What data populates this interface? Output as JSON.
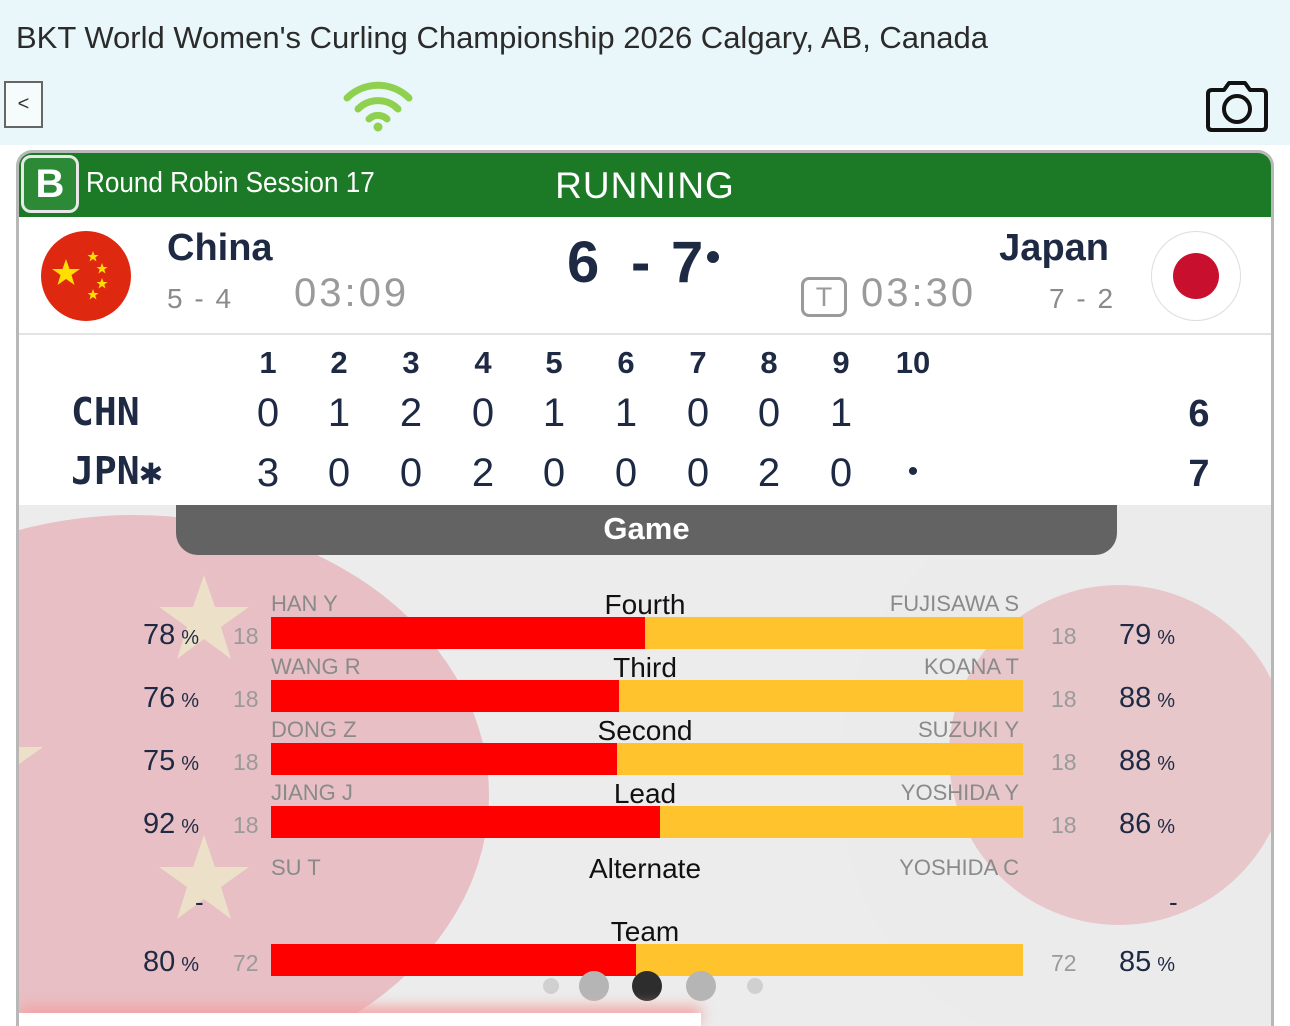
{
  "app": {
    "title": "BKT World Women's Curling Championship 2026 Calgary, AB, Canada",
    "back_label": "<",
    "icons": {
      "connection": "wifi-icon",
      "screenshot": "camera-icon"
    }
  },
  "game": {
    "sheet": "B",
    "session": "Round Robin Session 17",
    "status": "RUNNING",
    "timeout_label": "T",
    "teams": {
      "china": {
        "name": "China",
        "code": "CHN",
        "record": "5 - 4",
        "clock": "03:09",
        "score": "6",
        "total": "6",
        "flag_color": "#de2910"
      },
      "japan": {
        "name": "Japan",
        "code": "JPN",
        "hammer_mark": "✱",
        "record": "7 - 2",
        "clock": "03:30",
        "score": "7",
        "total": "7",
        "flag_color": "#c8102e"
      }
    },
    "score_dash": "-",
    "ends": [
      "1",
      "2",
      "3",
      "4",
      "5",
      "6",
      "7",
      "8",
      "9",
      "10"
    ],
    "linescore": {
      "china": [
        "0",
        "1",
        "2",
        "0",
        "1",
        "1",
        "0",
        "0",
        "1",
        ""
      ],
      "japan": [
        "3",
        "0",
        "0",
        "2",
        "0",
        "0",
        "0",
        "2",
        "0",
        "•"
      ]
    }
  },
  "stats": {
    "tab_label": "Game",
    "percent_unit": "%",
    "rows": [
      {
        "position": "Fourth",
        "left_name": "HAN Y",
        "right_name": "FUJISAWA S",
        "left_pct": "78",
        "left_shots": "18",
        "right_pct": "79",
        "right_shots": "18",
        "left_share": 0.497
      },
      {
        "position": "Third",
        "left_name": "WANG R",
        "right_name": "KOANA T",
        "left_pct": "76",
        "left_shots": "18",
        "right_pct": "88",
        "right_shots": "18",
        "left_share": 0.463
      },
      {
        "position": "Second",
        "left_name": "DONG Z",
        "right_name": "SUZUKI Y",
        "left_pct": "75",
        "left_shots": "18",
        "right_pct": "88",
        "right_shots": "18",
        "left_share": 0.46
      },
      {
        "position": "Lead",
        "left_name": "JIANG J",
        "right_name": "YOSHIDA Y",
        "left_pct": "92",
        "left_shots": "18",
        "right_pct": "86",
        "right_shots": "18",
        "left_share": 0.517
      }
    ],
    "alternate": {
      "position": "Alternate",
      "left_name": "SU T",
      "right_name": "YOSHIDA C",
      "left_value": "-",
      "right_value": "-"
    },
    "team": {
      "position": "Team",
      "left_pct": "80",
      "left_shots": "72",
      "right_pct": "85",
      "right_shots": "72",
      "left_share": 0.485
    },
    "colors": {
      "china_bar": "#ff0000",
      "japan_bar": "#ffc42d"
    },
    "pager": {
      "pages": 5,
      "active": 2
    }
  }
}
